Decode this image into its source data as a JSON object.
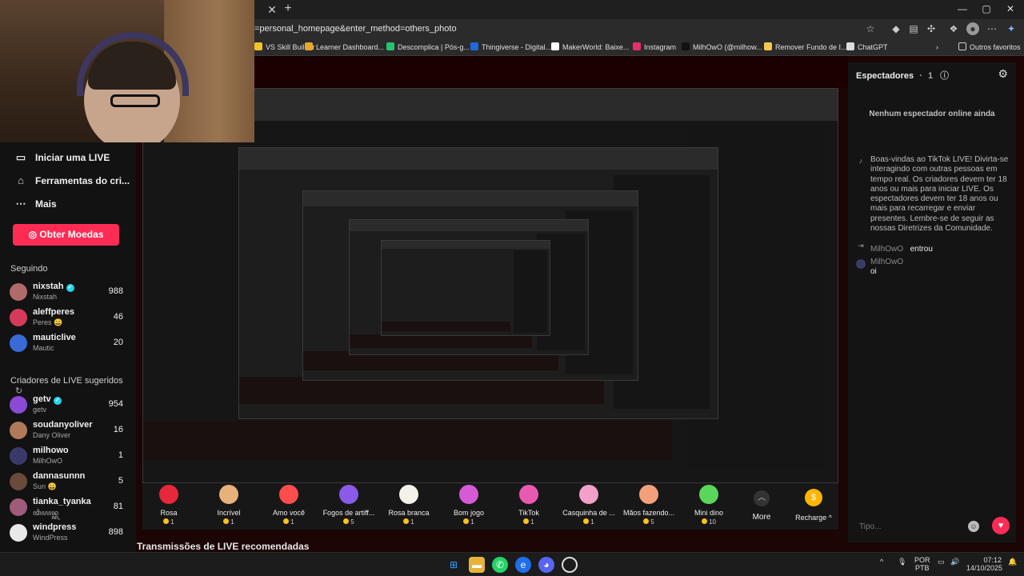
{
  "browser": {
    "url": "=personal_homepage&enter_method=others_photo",
    "bookmarks": [
      {
        "label": "VS Skill Builder",
        "color": "#f4c22a"
      },
      {
        "label": "Learner Dashboard...",
        "color": "#e8a72a"
      },
      {
        "label": "Descomplica | Pós-g...",
        "color": "#24c36f"
      },
      {
        "label": "Thingiverse - Digital...",
        "color": "#1d69e0"
      },
      {
        "label": "MakerWorld: Baixe...",
        "color": "#ffffff"
      },
      {
        "label": "Instagram",
        "color": "#e1306c"
      },
      {
        "label": "MilhOwO (@milhow...",
        "color": "#111111"
      },
      {
        "label": "Remover Fundo de I...",
        "color": "#f2c94c"
      },
      {
        "label": "ChatGPT",
        "color": "#dddddd"
      }
    ],
    "other_favorites": "Outros favoritos"
  },
  "sidebar": {
    "menu": [
      {
        "icon": "video-camera-icon",
        "label": "Iniciar uma LIVE"
      },
      {
        "icon": "home-icon",
        "label": "Ferramentas do cri..."
      },
      {
        "icon": "more-dots-icon",
        "label": "Mais"
      }
    ],
    "coins_button": "Obter Moedas",
    "following_title": "Seguindo",
    "following": [
      {
        "name": "nixstah",
        "sub": "Nixstah",
        "count": "988",
        "verified": true,
        "color": "#b06a6a"
      },
      {
        "name": "aleffperes",
        "sub": "Peres 😀",
        "count": "46",
        "verified": false,
        "color": "#d63a5a"
      },
      {
        "name": "mauticlive",
        "sub": "Mautic",
        "count": "20",
        "verified": false,
        "color": "#3a6ad6"
      }
    ],
    "suggested_title": "Criadores de LIVE sugeridos",
    "suggested": [
      {
        "name": "getv",
        "sub": "getv",
        "count": "954",
        "verified": true,
        "color": "#8a4ad6"
      },
      {
        "name": "soudanyoliver",
        "sub": "Dany Oliver",
        "count": "16",
        "verified": false,
        "color": "#b07a5a"
      },
      {
        "name": "milhowo",
        "sub": "MilhOwO",
        "count": "1",
        "verified": false,
        "color": "#3a3a6a"
      },
      {
        "name": "dannasunnn",
        "sub": "Sun 😀",
        "count": "5",
        "verified": false,
        "color": "#6a4a3a"
      },
      {
        "name": "tianka_tyanka",
        "sub": "ꦠꦶꦪꦤ꧀ꦏ",
        "count": "81",
        "verified": false,
        "color": "#a05a7a"
      },
      {
        "name": "windpress",
        "sub": "WindPress",
        "count": "898",
        "verified": false,
        "color": "#e8e8e8"
      }
    ]
  },
  "gifts": [
    {
      "name": "Rosa",
      "price": "1",
      "color": "#e5283c"
    },
    {
      "name": "Incrível",
      "price": "1",
      "color": "#e8b07a"
    },
    {
      "name": "Amo você",
      "price": "1",
      "color": "#ff4d4d"
    },
    {
      "name": "Fogos de artiff...",
      "price": "5",
      "color": "#8a5ae8"
    },
    {
      "name": "Rosa branca",
      "price": "1",
      "color": "#f2f2e8"
    },
    {
      "name": "Bom jogo",
      "price": "1",
      "color": "#d65ad6"
    },
    {
      "name": "TikTok",
      "price": "1",
      "color": "#e85ab0"
    },
    {
      "name": "Casquinha de ...",
      "price": "1",
      "color": "#f2a0c8"
    },
    {
      "name": "Mãos fazendo...",
      "price": "5",
      "color": "#f2a07a"
    },
    {
      "name": "Mini dino",
      "price": "10",
      "color": "#5ad65a"
    }
  ],
  "more_label": "More",
  "recharge_label": "Recharge",
  "recommended_title": "Transmissões de LIVE recomendadas",
  "viewers_panel": {
    "title": "Espectadores",
    "count": "1",
    "empty_message": "Nenhum espectador online ainda",
    "welcome": "Boas-vindas ao TikTok LIVE! Divirta-se interagindo com outras pessoas em tempo real. Os criadores devem ter 18 anos ou mais para iniciar LIVE. Os espectadores devem ter 18 anos ou mais para recarregar e enviar presentes. Lembre-se de seguir as nossas Diretrizes da Comunidade.",
    "events": [
      {
        "user": "MilhOwO",
        "text": "entrou"
      },
      {
        "user": "MilhOwO",
        "text": "oi"
      }
    ],
    "input_placeholder": "Tipo..."
  },
  "taskbar": {
    "lang": "POR",
    "lang2": "PTB",
    "time": "07:12",
    "date": "14/10/2025"
  }
}
